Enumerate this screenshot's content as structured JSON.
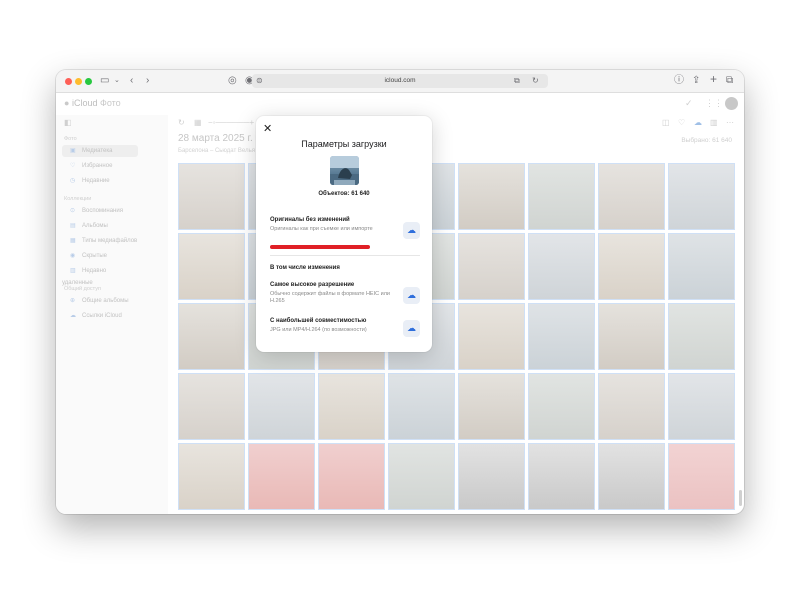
{
  "browser": {
    "url": "icloud.com"
  },
  "app": {
    "brand": "iCloud",
    "name": "Фото"
  },
  "sidebar": {
    "photos_section": "Фото",
    "photos_items": [
      {
        "label": "Медиатека",
        "icon": "photos-library-icon"
      },
      {
        "label": "Избранное",
        "icon": "heart-icon"
      },
      {
        "label": "Недавние",
        "icon": "clock-icon"
      }
    ],
    "collections_section": "Коллекции",
    "collection_items": [
      {
        "label": "Воспоминания",
        "icon": "memories-icon"
      },
      {
        "label": "Альбомы",
        "icon": "albums-icon"
      },
      {
        "label": "Типы медиафайлов",
        "icon": "media-types-icon"
      },
      {
        "label": "Скрытые",
        "icon": "hidden-eye-icon"
      },
      {
        "label": "Недавно удаленные",
        "icon": "trash-icon"
      }
    ],
    "sharing_section": "Общий доступ",
    "sharing_items": [
      {
        "label": "Общие альбомы",
        "icon": "shared-albums-icon"
      },
      {
        "label": "Ссылки iCloud",
        "icon": "icloud-links-icon"
      }
    ]
  },
  "content": {
    "date_heading": "28 марта 2025 г.",
    "location": "Барселона – Сьюдат Велья",
    "selected_count": "Выбрано: 61 640"
  },
  "modal": {
    "title": "Параметры загрузки",
    "count_label": "Объектов: 61 640",
    "originals_title": "Оригиналы без изменений",
    "originals_subtitle": "Оригиналы как при съемке или импорте",
    "edits_section": "В том числе изменения",
    "highest_title": "Самое высокое разрешение",
    "highest_subtitle": "Обычно содержит файлы в формате HEIC или H.265",
    "compat_title": "С наибольшей совместимостью",
    "compat_subtitle": "JPG или MP4/H.264 (по возможности)"
  },
  "colors": {
    "accent": "#2f6fdc",
    "highlight": "#e01f26"
  }
}
